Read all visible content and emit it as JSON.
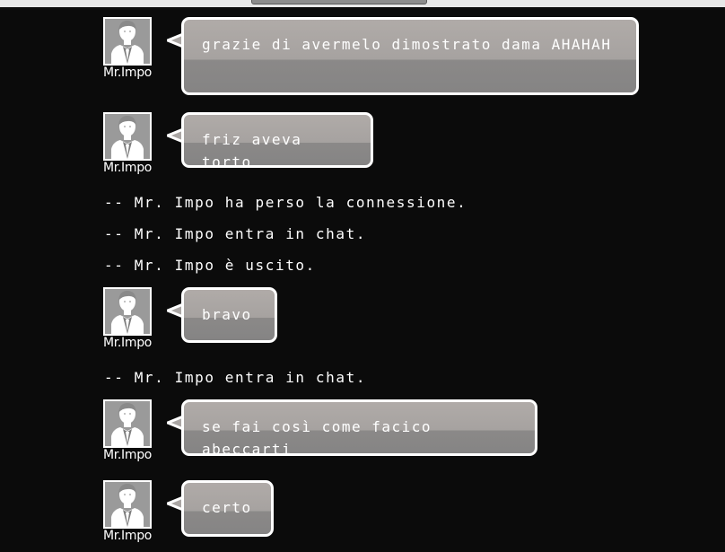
{
  "colors": {
    "background": "#0b0b0b",
    "bubble_top": "#b0aba8",
    "bubble_bottom": "#858484",
    "bubble_border": "#ffffff",
    "text": "#ffffff"
  },
  "chat": {
    "messages": [
      {
        "user": "Mr.Impo",
        "avatar_icon": "user-avatar-icon",
        "text": "grazie di avermelo dimostrato dama AHAHAH"
      },
      {
        "user": "Mr.Impo",
        "avatar_icon": "user-avatar-icon",
        "text": "friz aveva torto"
      },
      {
        "system": "-- Mr. Impo ha perso la connessione."
      },
      {
        "system": "-- Mr. Impo entra in chat."
      },
      {
        "system": "-- Mr. Impo è uscito."
      },
      {
        "user": "Mr.Impo",
        "avatar_icon": "user-avatar-icon",
        "text": "bravo"
      },
      {
        "system": "-- Mr. Impo entra in chat."
      },
      {
        "user": "Mr.Impo",
        "avatar_icon": "user-avatar-icon",
        "text": "se fai così come facico abeccarti"
      },
      {
        "user": "Mr.Impo",
        "avatar_icon": "user-avatar-icon",
        "text": "certo"
      }
    ]
  }
}
